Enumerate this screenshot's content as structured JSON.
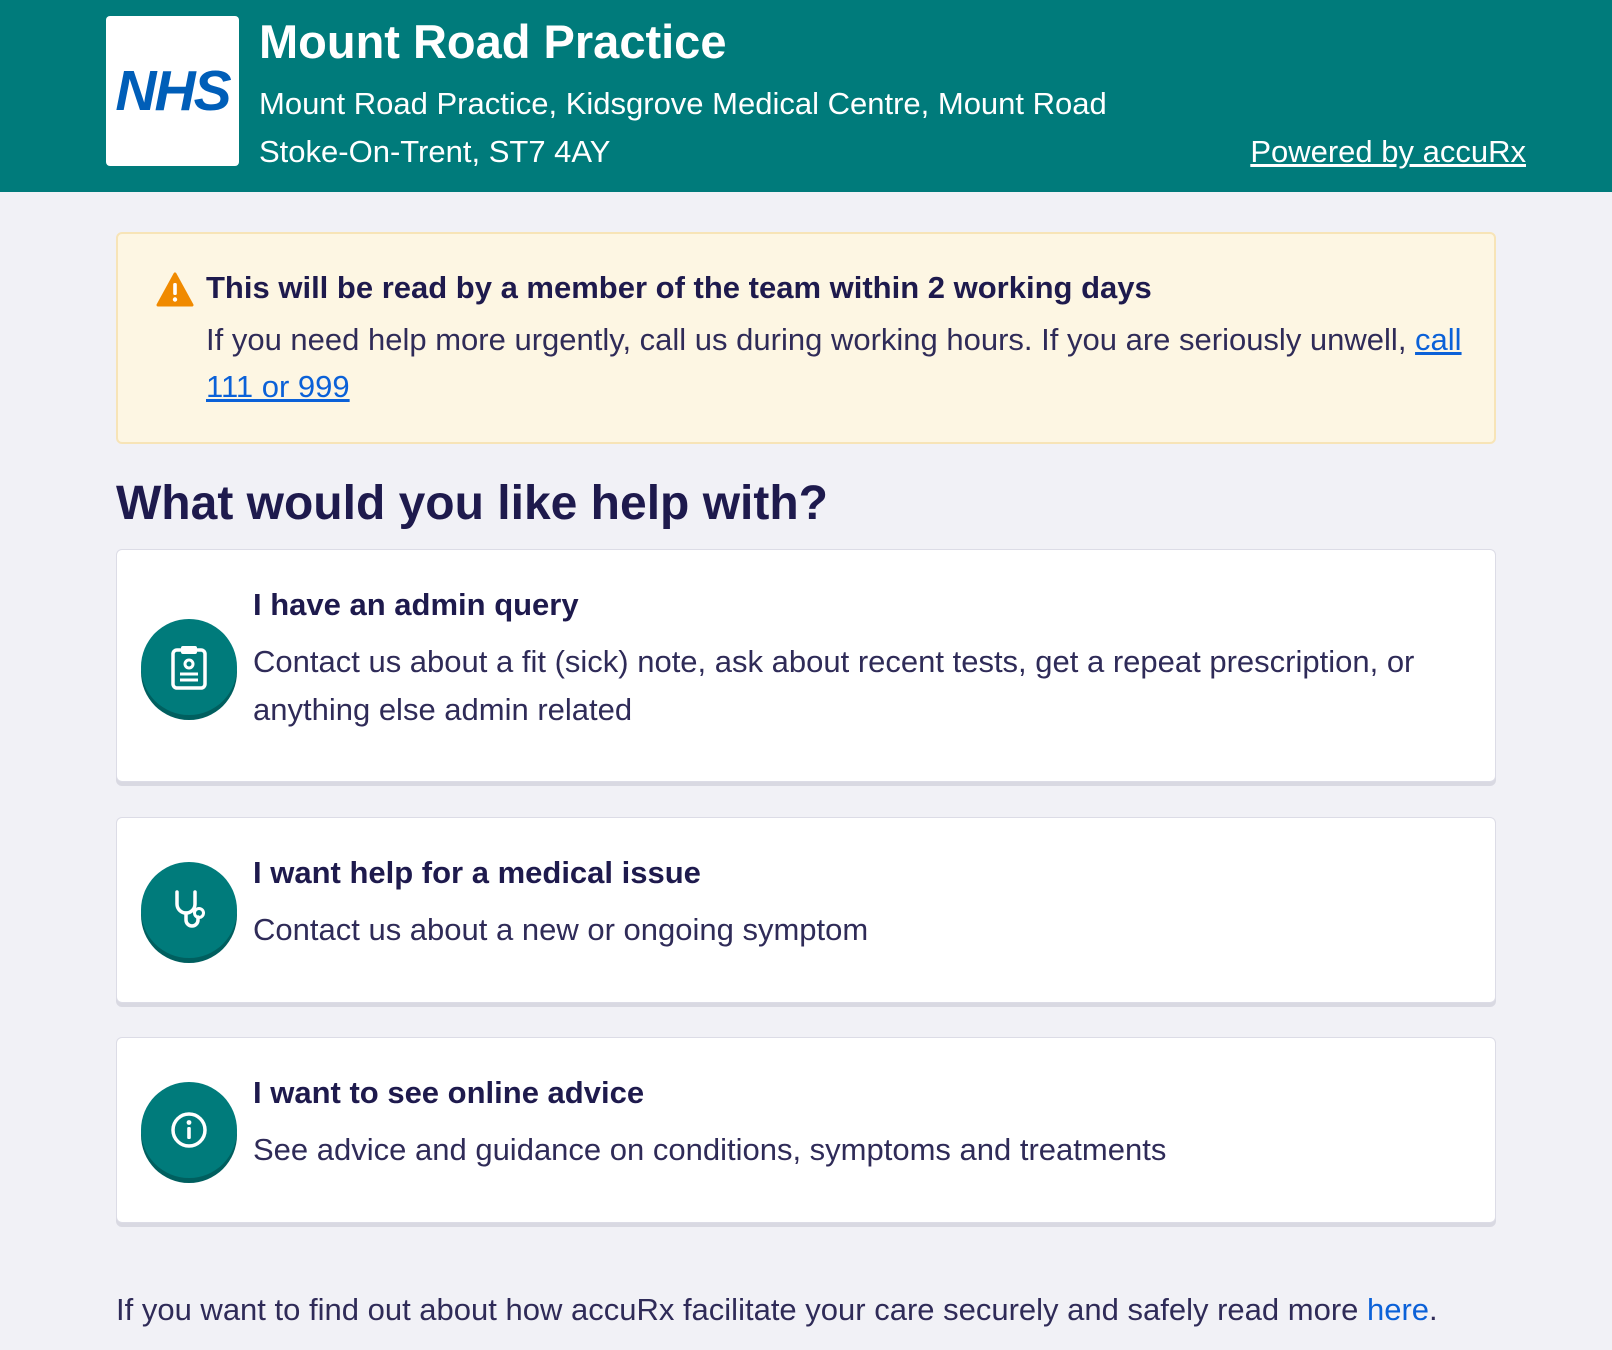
{
  "header": {
    "logo_text": "NHS",
    "practice_name": "Mount Road Practice",
    "address_line1": "Mount Road Practice, Kidsgrove Medical Centre, Mount Road",
    "address_line2": "Stoke-On-Trent, ST7 4AY",
    "powered_by": "Powered by accuRx"
  },
  "warning": {
    "icon": "warning-triangle-icon",
    "title": "This will be read by a member of the team within 2 working days",
    "body": "If you need help more urgently, call us during working hours. If you are seriously unwell, ",
    "link": "call 111 or 999"
  },
  "main": {
    "heading": "What would you like help with?",
    "options": [
      {
        "icon": "clipboard-icon",
        "title": "I have an admin query",
        "description": "Contact us about a fit (sick) note, ask about recent tests, get a repeat prescription, or anything else admin related"
      },
      {
        "icon": "stethoscope-icon",
        "title": "I want help for a medical issue",
        "description": "Contact us about a new or ongoing symptom"
      },
      {
        "icon": "info-icon",
        "title": "I want to see online advice",
        "description": "See advice and guidance on conditions, symptoms and treatments"
      }
    ]
  },
  "footer": {
    "text": "If you want to find out about how accuRx facilitate your care securely and safely read more ",
    "link": "here",
    "end": "."
  },
  "colors": {
    "header_bg": "#007b7b",
    "page_bg": "#f1f1f6",
    "warning_bg": "#fdf6e3",
    "warning_icon": "#f08a00",
    "link": "#0b61d8",
    "nhs_blue": "#005eb8",
    "text": "#1e1a4d"
  }
}
